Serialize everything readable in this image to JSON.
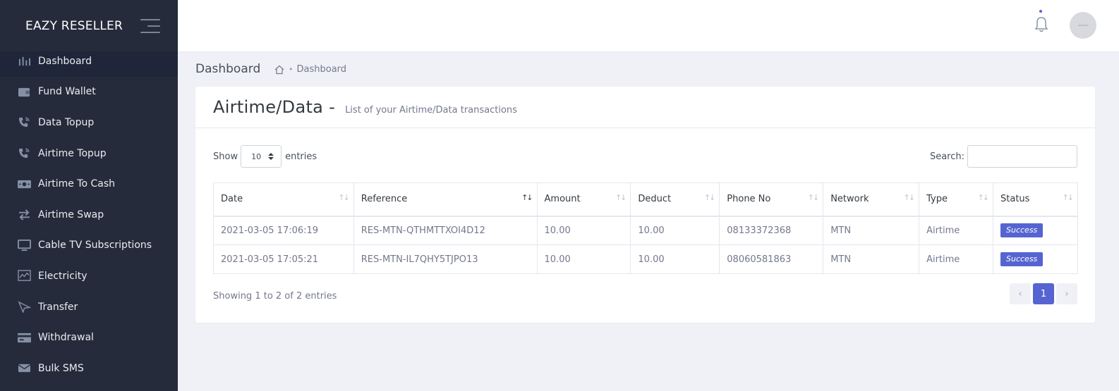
{
  "brand": {
    "name": "EAZY RESELLER"
  },
  "sidebar": {
    "items": [
      {
        "label": "Dashboard",
        "icon": "dashboard-icon"
      },
      {
        "label": "Fund Wallet",
        "icon": "wallet-icon"
      },
      {
        "label": "Data Topup",
        "icon": "phone-call-icon"
      },
      {
        "label": "Airtime Topup",
        "icon": "phone-call-icon"
      },
      {
        "label": "Airtime To Cash",
        "icon": "money-icon"
      },
      {
        "label": "Airtime Swap",
        "icon": "swap-icon"
      },
      {
        "label": "Cable TV Subscriptions",
        "icon": "tv-icon"
      },
      {
        "label": "Electricity",
        "icon": "chart-icon"
      },
      {
        "label": "Transfer",
        "icon": "send-icon"
      },
      {
        "label": "Withdrawal",
        "icon": "card-icon"
      },
      {
        "label": "Bulk SMS",
        "icon": "mail-icon"
      }
    ]
  },
  "header": {
    "page_title": "Dashboard",
    "breadcrumb": [
      "Dashboard"
    ]
  },
  "card": {
    "title": "Airtime/Data -",
    "subtitle": "List of your Airtime/Data transactions",
    "show_label": "Show",
    "entries_label": "entries",
    "page_size": "10",
    "search_label": "Search:",
    "search_value": "",
    "info": "Showing 1 to 2 of 2 entries"
  },
  "table": {
    "columns": [
      "Date",
      "Reference",
      "Amount",
      "Deduct",
      "Phone No",
      "Network",
      "Type",
      "Status"
    ],
    "rows": [
      {
        "date": "2021-03-05 17:06:19",
        "reference": "RES-MTN-QTHMTTXOI4D12",
        "amount": "10.00",
        "deduct": "10.00",
        "phone": "08133372368",
        "network": "MTN",
        "type": "Airtime",
        "status": "Success"
      },
      {
        "date": "2021-03-05 17:05:21",
        "reference": "RES-MTN-IL7QHY5TJPO13",
        "amount": "10.00",
        "deduct": "10.00",
        "phone": "08060581863",
        "network": "MTN",
        "type": "Airtime",
        "status": "Success"
      }
    ]
  },
  "pagination": {
    "prev": "‹",
    "current": "1",
    "next": "›"
  },
  "colors": {
    "sidebar_bg": "#252b3b",
    "accent": "#5664d2",
    "page_bg": "#f0f1f6"
  }
}
